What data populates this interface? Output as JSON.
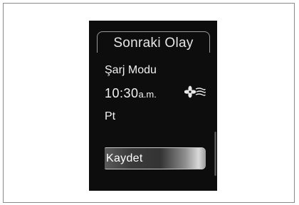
{
  "header": {
    "title": "Sonraki Olay"
  },
  "event": {
    "mode": "Şarj Modu",
    "time": "10:30",
    "ampm": "a.m.",
    "day": "Pt",
    "climate_icon": "fan-icon"
  },
  "actions": {
    "save_label": "Kaydet"
  }
}
